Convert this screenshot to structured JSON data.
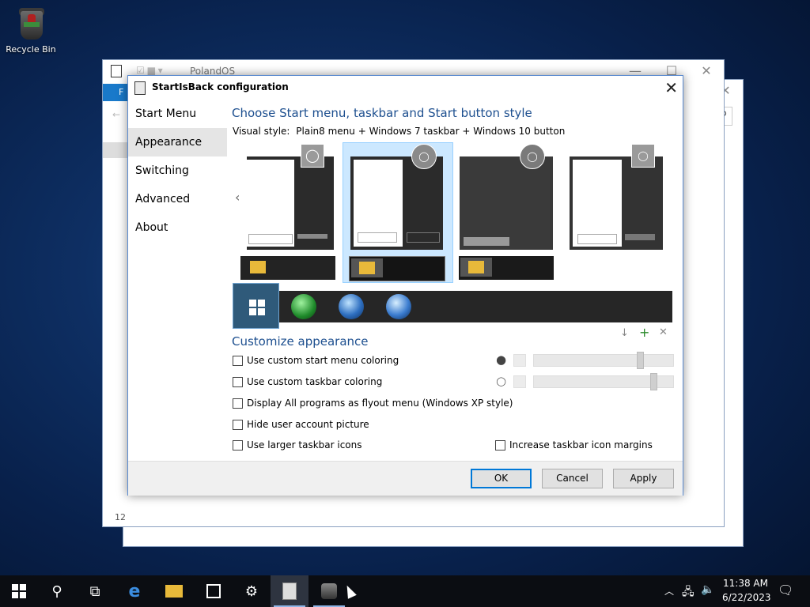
{
  "desktop": {
    "recycle_bin_label": "Recycle Bin"
  },
  "explorer_back": {
    "title": "PolandOS",
    "ribbon_tab": "F",
    "status_count": "12"
  },
  "dialog": {
    "title": "StartIsBack configuration",
    "nav": [
      "Start Menu",
      "Appearance",
      "Switching",
      "Advanced",
      "About"
    ],
    "selected_nav": "Appearance",
    "section_title": "Choose Start menu, taskbar and Start button style",
    "visual_style_label": "Visual style:",
    "visual_style_value": "Plain8 menu + Windows 7 taskbar + Windows 10 button",
    "customize_title": "Customize appearance",
    "checkboxes": {
      "custom_start_menu_coloring": "Use custom start menu coloring",
      "custom_taskbar_coloring": "Use custom taskbar coloring",
      "all_programs_flyout": "Display All programs as flyout menu (Windows XP style)",
      "hide_user_picture": "Hide user account picture",
      "larger_taskbar_icons": "Use larger taskbar icons",
      "increase_margins": "Increase taskbar icon margins"
    },
    "sliders": {
      "start_menu_opacity": 0.78,
      "taskbar_opacity": 0.88
    },
    "buttons": {
      "ok": "OK",
      "cancel": "Cancel",
      "apply": "Apply"
    }
  },
  "taskbar": {
    "time": "11:38 AM",
    "date": "6/22/2023",
    "accent": "#0078d7"
  }
}
